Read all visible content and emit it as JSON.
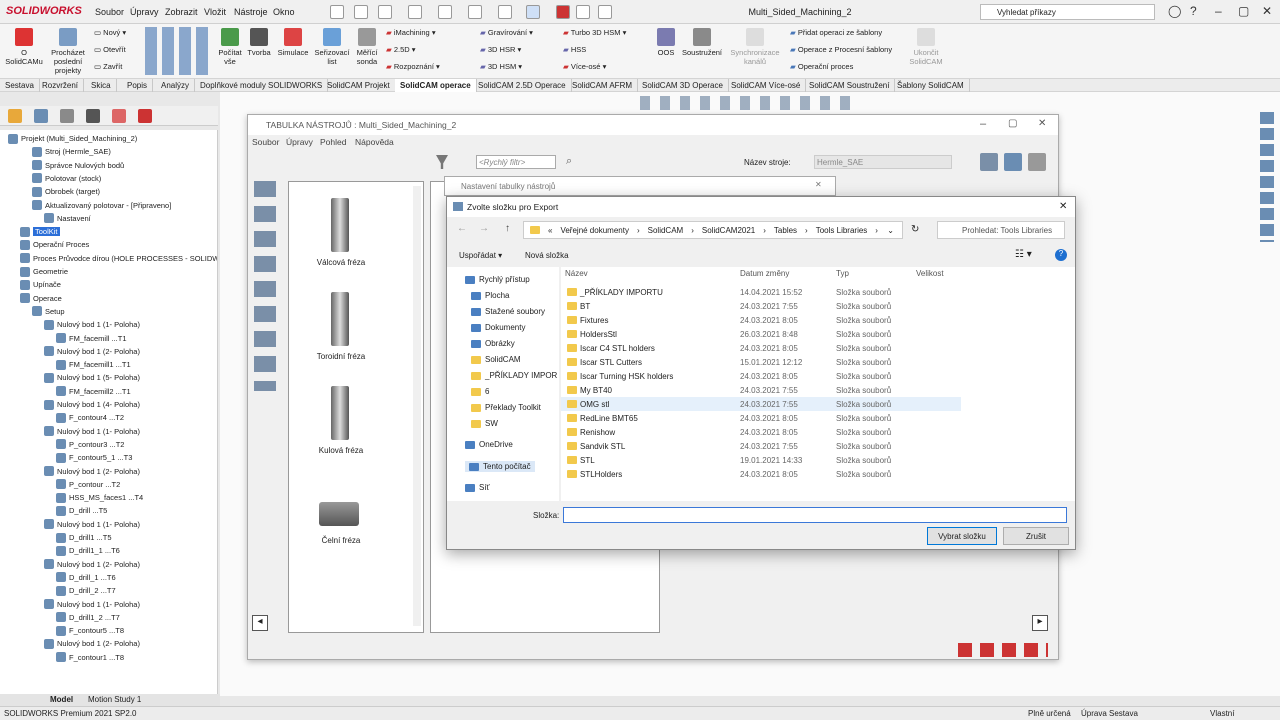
{
  "app": {
    "logo": "SOLIDWORKS",
    "menu": [
      "Soubor",
      "Úpravy",
      "Zobrazit",
      "Vložit",
      "Nástroje",
      "Okno"
    ],
    "doc_title": "Multi_Sided_Machining_2",
    "search_placeholder": "Vyhledat příkazy"
  },
  "ribbon": {
    "big": [
      "O SolidCAMu",
      "Procházet poslední projekty"
    ],
    "small1": [
      "Nový",
      "Otevřít",
      "Zavřít"
    ],
    "big2": [
      "Počítat vše",
      "Tvorba",
      "Simulace",
      "Seřizovací list",
      "Měřící sonda"
    ],
    "ops1": [
      "iMachining",
      "2.5D",
      "Rozpoznání"
    ],
    "ops2": [
      "Gravírování",
      "3D HSR",
      "3D HSM"
    ],
    "ops3": [
      "Turbo 3D HSM",
      "HSS",
      "Více-osé"
    ],
    "big3": [
      "OOS",
      "Soustružení",
      "Synchronizace kanálů",
      "Ukončit SolidCAM"
    ],
    "templ": [
      "Přidat operaci ze šablony",
      "Operace z Procesní šablony",
      "Operační proces"
    ]
  },
  "tabs": [
    "Sestava",
    "Rozvržení",
    "Skica",
    "Popis",
    "Analýzy",
    "Doplňkové moduly SOLIDWORKS",
    "SolidCAM Projekt",
    "SolidCAM operace",
    "SolidCAM 2.5D Operace",
    "SolidCAM AFRM",
    "SolidCAM 3D Operace",
    "SolidCAM Více-osé",
    "SolidCAM Soustružení",
    "Šablony SolidCAM"
  ],
  "tree": [
    {
      "d": 0,
      "t": "Projekt (Multi_Sided_Machining_2)"
    },
    {
      "d": 2,
      "t": "Stroj (Hermle_SAE)"
    },
    {
      "d": 2,
      "t": "Správce Nulových bodů"
    },
    {
      "d": 2,
      "t": "Polotovar (stock)"
    },
    {
      "d": 2,
      "t": "Obrobek (target)"
    },
    {
      "d": 2,
      "t": "Aktualizovaný polotovar - [Připraveno]"
    },
    {
      "d": 3,
      "t": "Nastavení"
    },
    {
      "d": 1,
      "t": "ToolKit",
      "sel": true
    },
    {
      "d": 1,
      "t": "Operační Proces"
    },
    {
      "d": 1,
      "t": "Proces Průvodce dírou (HOLE PROCESSES - SOLIDWO"
    },
    {
      "d": 1,
      "t": "Geometrie"
    },
    {
      "d": 1,
      "t": "Upínače"
    },
    {
      "d": 1,
      "t": "Operace"
    },
    {
      "d": 2,
      "t": "Setup"
    },
    {
      "d": 3,
      "t": "Nulový bod 1 (1- Poloha)"
    },
    {
      "d": 4,
      "t": "FM_facemill ...T1"
    },
    {
      "d": 3,
      "t": "Nulový bod 1 (2- Poloha)"
    },
    {
      "d": 4,
      "t": "FM_facemill1 ...T1"
    },
    {
      "d": 3,
      "t": "Nulový bod 1 (5- Poloha)"
    },
    {
      "d": 4,
      "t": "FM_facemill2 ...T1"
    },
    {
      "d": 3,
      "t": "Nulový bod 1 (4- Poloha)"
    },
    {
      "d": 4,
      "t": "F_contour4 ...T2"
    },
    {
      "d": 3,
      "t": "Nulový bod 1 (1- Poloha)"
    },
    {
      "d": 4,
      "t": "P_contour3 ...T2"
    },
    {
      "d": 4,
      "t": "F_contour5_1 ...T3"
    },
    {
      "d": 3,
      "t": "Nulový bod 1 (2- Poloha)"
    },
    {
      "d": 4,
      "t": "P_contour ...T2"
    },
    {
      "d": 4,
      "t": "HSS_MS_faces1 ...T4"
    },
    {
      "d": 4,
      "t": "D_drill ...T5"
    },
    {
      "d": 3,
      "t": "Nulový bod 1 (1- Poloha)"
    },
    {
      "d": 4,
      "t": "D_drill1 ...T5"
    },
    {
      "d": 4,
      "t": "D_drill1_1 ...T6"
    },
    {
      "d": 3,
      "t": "Nulový bod 1 (2- Poloha)"
    },
    {
      "d": 4,
      "t": "D_drill_1 ...T6"
    },
    {
      "d": 4,
      "t": "D_drill_2 ...T7"
    },
    {
      "d": 3,
      "t": "Nulový bod 1 (1- Poloha)"
    },
    {
      "d": 4,
      "t": "D_drill1_2 ...T7"
    },
    {
      "d": 4,
      "t": "F_contour5 ...T8"
    },
    {
      "d": 3,
      "t": "Nulový bod 1 (2- Poloha)"
    },
    {
      "d": 4,
      "t": "F_contour1 ...T8"
    }
  ],
  "bottom_tabs": [
    "Model",
    "Motion Study 1"
  ],
  "status": {
    "left": "SOLIDWORKS Premium 2021 SP2.0",
    "s1": "Plně určená",
    "s2": "Úprava Sestava",
    "s3": "Vlastní"
  },
  "tooltable": {
    "title": "TABULKA NÁSTROJŮ : Multi_Sided_Machining_2",
    "menu": [
      "Soubor",
      "Úpravy",
      "Pohled",
      "Nápověda"
    ],
    "filter": "<Rychlý filtr>",
    "machine_label": "Název stroje:",
    "machine": "Hermle_SAE",
    "tools": [
      "Válcová fréza",
      "Toroidní fréza",
      "Kulová fréza",
      "Čelní fréza"
    ],
    "nastaveni": "Nastavení tabulky nástrojů"
  },
  "dialog": {
    "title": "Zvolte složku pro Export",
    "path": [
      "«",
      "Veřejné dokumenty",
      "SolidCAM",
      "SolidCAM2021",
      "Tables",
      "Tools Libraries"
    ],
    "search": "Prohledat: Tools Libraries",
    "organize": "Uspořádat",
    "new_folder": "Nová složka",
    "nav": [
      "Rychlý přístup",
      "Plocha",
      "Stažené soubory",
      "Dokumenty",
      "Obrázky",
      "SolidCAM",
      "_PŘÍKLADY IMPOR",
      "6",
      "Překlady Toolkit",
      "SW",
      "OneDrive",
      "Tento počítač",
      "Síť"
    ],
    "cols": [
      "Název",
      "Datum změny",
      "Typ",
      "Velikost"
    ],
    "files": [
      [
        "_PŘÍKLADY IMPORTU",
        "14.04.2021 15:52",
        "Složka souborů"
      ],
      [
        "BT",
        "24.03.2021 7:55",
        "Složka souborů"
      ],
      [
        "Fixtures",
        "24.03.2021 8:05",
        "Složka souborů"
      ],
      [
        "HoldersStl",
        "26.03.2021 8:48",
        "Složka souborů"
      ],
      [
        "Iscar C4 STL holders",
        "24.03.2021 8:05",
        "Složka souborů"
      ],
      [
        "Iscar STL Cutters",
        "15.01.2021 12:12",
        "Složka souborů"
      ],
      [
        "Iscar Turning HSK holders",
        "24.03.2021 8:05",
        "Složka souborů"
      ],
      [
        "My BT40",
        "24.03.2021 7:55",
        "Složka souborů"
      ],
      [
        "OMG stl",
        "24.03.2021 7:55",
        "Složka souborů"
      ],
      [
        "RedLine BMT65",
        "24.03.2021 8:05",
        "Složka souborů"
      ],
      [
        "Renishow",
        "24.03.2021 8:05",
        "Složka souborů"
      ],
      [
        "Sandvik STL",
        "24.03.2021 7:55",
        "Složka souborů"
      ],
      [
        "STL",
        "19.01.2021 14:33",
        "Složka souborů"
      ],
      [
        "STLHolders",
        "24.03.2021 8:05",
        "Složka souborů"
      ]
    ],
    "folder_label": "Složka:",
    "folder_value": "",
    "select": "Vybrat složku",
    "cancel": "Zrušit"
  }
}
